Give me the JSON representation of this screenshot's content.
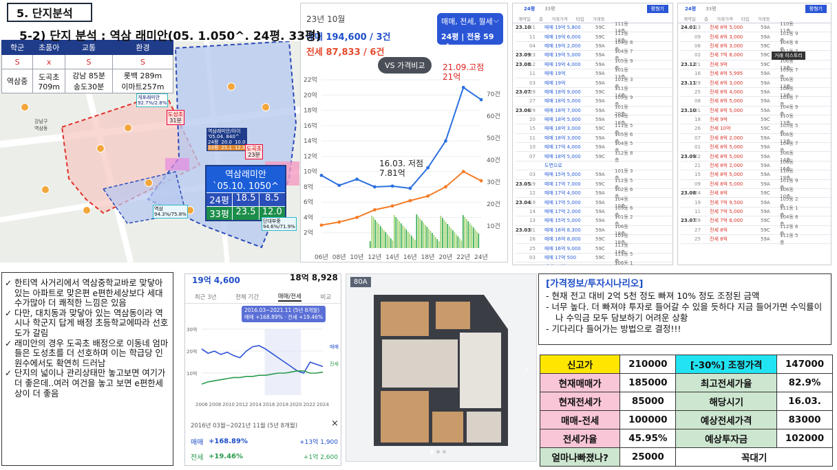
{
  "section_title": "5. 단지분석",
  "sub_title": "5-2) 단지 분석 : 역삼 래미안(05. 1.050^. 24평. 33평)",
  "school_table": {
    "headers": [
      "학군",
      "초품아",
      "교통",
      "환경"
    ],
    "grades": [
      "S",
      "x",
      "S",
      "S"
    ],
    "details": [
      "역삼중",
      "도곡초\n709m",
      "강남 85분\n송도30분",
      "롯백 289m\n이마트257m"
    ]
  },
  "map": {
    "labels": {
      "complex_main": "역삼래미안",
      "complex_year": "`05.10. 1050^",
      "row24": [
        "24평",
        "18.5",
        "8.5"
      ],
      "row33": [
        "33평",
        "23.5",
        "12.0"
      ],
      "pin_doseong": "도성초",
      "pin_doseong_d": "31분",
      "pin_dogok": "도곡초",
      "pin_dogok_d": "23분",
      "tag_a": "개포래미안\n92.7%/2.8%",
      "tag_b": "역삼래미안/아이\n'05.04. 840^",
      "tag_c": "역삼\n94.3%/75.8%",
      "tag_d": "단대부중\n94.6%/71.9%",
      "mini_rows": [
        [
          "24평",
          "20.0",
          "10.0"
        ],
        [
          "33평",
          "25.1",
          "12.9"
        ]
      ],
      "station": "강남구\n역삼동"
    }
  },
  "price_panel": {
    "month": "23년 10월",
    "sale": "매매 194,600 / 3건",
    "jeonse": "전세 87,833 / 6건",
    "filter": "매매, 전세, 월세",
    "pyeong": "24평 | 전용 59㎡",
    "vs_button": "VS 가격비교",
    "ann_high": "21.09.고점\n21억",
    "ann_low": "16.03. 저점\n7.81억"
  },
  "chart_data": {
    "type": "line",
    "x": [
      "06년",
      "08년",
      "10년",
      "12년",
      "14년",
      "16년",
      "18년",
      "20년",
      "22년",
      "24년"
    ],
    "y_left_ticks": [
      "2억",
      "4억",
      "6억",
      "8억",
      "10억",
      "12억",
      "14억",
      "16억",
      "18억",
      "20억",
      "22억"
    ],
    "y_right_ticks": [
      "10건",
      "20건",
      "30건",
      "40건",
      "50건",
      "60건",
      "70건"
    ],
    "series": [
      {
        "name": "매매",
        "values": [
          9.5,
          8.2,
          9.0,
          8.0,
          8.1,
          7.81,
          10.5,
          14.0,
          21.0,
          19.4
        ]
      },
      {
        "name": "전세",
        "values": [
          3.0,
          3.4,
          4.0,
          5.0,
          5.5,
          6.2,
          6.8,
          8.0,
          10.0,
          8.8
        ]
      }
    ],
    "ylim": [
      0,
      23
    ]
  },
  "tx_list_1": {
    "tabs": [
      "24평",
      "33평"
    ],
    "btn": "평형기",
    "header": [
      "계약일",
      "층",
      "거래가격",
      "타입",
      "거래동"
    ],
    "rows": [
      [
        "23.10",
        "21",
        "매매 19억 5,800",
        "59C",
        "111동 14층"
      ],
      [
        "",
        "11",
        "매매 19억 6,000",
        "59C",
        "111동 18층"
      ],
      [
        "",
        "04",
        "매매 19억 2,000",
        "59A",
        "104동 8층"
      ],
      [
        "23.09",
        "23",
        "매매 19억 5,000",
        "59A",
        "104동 7층"
      ],
      [
        "23.08",
        "12",
        "매매 19억 4,000",
        "59A",
        "105동 9층"
      ],
      [
        "",
        "11",
        "매매 19억",
        "59A",
        "101동 13층"
      ],
      [
        "",
        "03",
        "매매 19억",
        "59A",
        "101동 3층"
      ],
      [
        "23.07",
        "29",
        "매매 18억 9,000",
        "59C",
        "111동 14층"
      ],
      [
        "",
        "27",
        "매매 18억 5,000",
        "59A",
        "105동 9층"
      ],
      [
        "23.06",
        "29",
        "매매 18억 7,000",
        "59A",
        "101동 20층"
      ],
      [
        "",
        "20",
        "매매 18억 5,000",
        "59A",
        "104동 18층"
      ],
      [
        "",
        "15",
        "매매 18억 3,000",
        "59C",
        "111동 5층"
      ],
      [
        "",
        "11",
        "매매 18억 3,000",
        "59A",
        "105동 6층"
      ],
      [
        "",
        "10",
        "매매 17억 4,000",
        "59A",
        "104동 5층"
      ],
      [
        "",
        "07",
        "매매 18억 5,000",
        "59C",
        "112동 8층"
      ],
      [
        "",
        "",
        "도면으로",
        "",
        ""
      ],
      [
        "",
        "03",
        "매매 15억 5,000",
        "59A",
        "101동 3층"
      ],
      [
        "23.05",
        "19",
        "매매 17억 7,000",
        "59C",
        "112동 5층"
      ],
      [
        "",
        "12",
        "매매 17억 4,000",
        "59A",
        "102동 6층"
      ],
      [
        "23.04",
        "19",
        "매매 17억 5,000",
        "59A",
        "104동 10층"
      ],
      [
        "",
        "14",
        "매매 17억 2,000",
        "59A",
        "105동 6층"
      ],
      [
        "",
        "13",
        "매매 15억 5,000",
        "59A",
        "101동 2층"
      ],
      [
        "23.03",
        "31",
        "매매 16억 8,300",
        "59A",
        "106동 18층"
      ],
      [
        "",
        "26",
        "매매 16억 8,000",
        "59C",
        "101동 18층"
      ],
      [
        "",
        "25",
        "매매 16억 9,000",
        "59C",
        "111동 14층"
      ],
      [
        "",
        "03",
        "매매 17억 500",
        "59C",
        "111동 5층"
      ],
      [
        "",
        "18",
        "매매 16억 1,000",
        "59A",
        "106동 1층"
      ],
      [
        "23.02",
        "25",
        "매매 16억 7,000",
        "59A",
        "105동 6층"
      ]
    ]
  },
  "tx_list_2": {
    "tabs": [
      "24평",
      "33평"
    ],
    "btn": "평형기",
    "tooltip": "거래 히스토리",
    "header": [
      "계약일",
      "층",
      "거래가격",
      "타입",
      "거래동"
    ],
    "rows": [
      [
        "24.01",
        "13",
        "전세 8억 5,000",
        "59A",
        "110동 11층"
      ],
      [
        "",
        "09",
        "전세 8억 3,000",
        "59A",
        "101동 9층"
      ],
      [
        "",
        "06",
        "전세 8억 3,000",
        "59C",
        "104동 8층"
      ],
      [
        "",
        "02",
        "전세 7억 8,000",
        "59C",
        "111동 7층"
      ],
      [
        "23.12",
        "21",
        "전세 9억",
        "59C",
        "106동 13층"
      ],
      [
        "",
        "16",
        "전세 8억 5,995",
        "59A",
        "105동 7층"
      ],
      [
        "23.11",
        "29",
        "전세 8억 3,000",
        "59A",
        "106동 13층"
      ],
      [
        "",
        "25",
        "전세 8억 4,000",
        "59A",
        "106동 13층"
      ],
      [
        "",
        "08",
        "전세 8억 5,000",
        "59A",
        "101동 7층"
      ],
      [
        "23.10",
        "31",
        "전세 8억 5,000",
        "59A",
        "104동 9층"
      ],
      [
        "",
        "18",
        "전세 9억",
        "59C",
        "110동 13층"
      ],
      [
        "",
        "26",
        "전세 10억",
        "59C",
        "105동 5층"
      ],
      [
        "",
        "07",
        "전세 8억 2,000",
        "59A",
        "106동 13층"
      ],
      [
        "",
        "01",
        "전세 8억 5,000",
        "59A",
        "104동 7층"
      ],
      [
        "23.09",
        "22",
        "전세 8억 5,000",
        "59A",
        "106동 14층"
      ],
      [
        "",
        "21",
        "전세 8억 2,000",
        "59A",
        "106동 16층"
      ],
      [
        "",
        "15",
        "전세 8억 5,000",
        "59A",
        "110동 19층"
      ],
      [
        "",
        "09",
        "전세 8억 5,000",
        "59A",
        "101동 9층"
      ],
      [
        "23.08",
        "24",
        "전세 8억",
        "59C",
        "106동 10층"
      ],
      [
        "",
        "19",
        "전세 7억 9,500",
        "59A",
        "105동 2층"
      ],
      [
        "",
        "11",
        "전세 7억 5,000",
        "59A",
        "111동 1층"
      ],
      [
        "23.07",
        "29",
        "전세 7억 8,000",
        "59C",
        "104동 8층"
      ],
      [
        "",
        "27",
        "전세 8억",
        "59C",
        "112동 6층"
      ],
      [
        "",
        "25",
        "전세 8억",
        "59A",
        "111동 5층"
      ]
    ]
  },
  "notes": [
    "한티역 사거리에서 역삼중학교바로 맞닿아 있는 아파트로 맞은편 e편한세상보다 세대수가많아 더 쾌적한 느낌은 있음",
    "다만, 대치동과 맞닿아 있는 역삼동이라 역시나 학군지 답게 배정 초등학교에따라 선호도가 갈림",
    "래미안의 경우 도곡초 배정으로 이동네 엄마들은 도성초를 더 선호하며 이는 학급당 인원수에서도 확연히 드러남",
    "단지의 넓이나 관리상태만 놓고보면 여기가 더 좋은데..여러 여건을 놓고 보면 e편한세상이 더 좋음"
  ],
  "small_chart": {
    "sale_top": "19억 4,600",
    "other_top": "18억 8,928",
    "tabs": [
      "최근 3년",
      "전체 기간",
      "매매/전세",
      "비교"
    ],
    "tooltip_period": "2016.03~2021.11 (5년 8개월)",
    "tooltip_vals": "매매 +168.89% · 전세 +19.46%",
    "y_ticks": [
      "30억",
      "20억",
      "10억"
    ],
    "x_ticks": [
      "2006",
      "2008",
      "2010",
      "2012",
      "2014",
      "2016",
      "2018",
      "2020",
      "2022",
      "2024"
    ],
    "legend_sale": "매매",
    "legend_jeonse": "전세",
    "period_label": "2016년 03월~2021년 11월 (5년 8개월)",
    "close_icon": "×",
    "sale_label": "매매",
    "sale_pct": "+168.89%",
    "sale_amt": "+13억 1,900",
    "jeonse_label": "전세",
    "jeonse_pct": "+19.46%",
    "jeonse_amt": "+1억 2,600"
  },
  "floorplan": {
    "badge": "80A"
  },
  "info_box": {
    "title": "[가격정보/투자시나리오]",
    "lines": [
      "-  현재 전고 대비 2억 5천 정도 빠져 10% 정도 조정된 금액",
      "-  너무 높다. 더 빠져야 투자로 들어갈 수 있을 듯하다 지금 들어가면 수익률이나 수익금 모두 담보하기 어려운 상황",
      "-  기다리다 들어가는 방법으로 결정!!!"
    ]
  },
  "price_table": [
    [
      "신고가",
      "210000",
      "[-30%] 조정가격",
      "147000"
    ],
    [
      "현재매매가",
      "185000",
      "최고전세가율",
      "82.9%"
    ],
    [
      "현재전세가",
      "85000",
      "해당시기",
      "16.03."
    ],
    [
      "매매-전세",
      "100000",
      "예상전세가격",
      "83000"
    ],
    [
      "전세가율",
      "45.95%",
      "예상투자금",
      "102000"
    ],
    [
      "얼마나빠졌나?",
      "25000",
      "꼭대기",
      ""
    ]
  ],
  "colors": {
    "navy": "#1f3c8a",
    "blue": "#2a56d6",
    "orange": "#f47c25",
    "red": "#d9342b",
    "yellow": "#ffe600",
    "cyan": "#22e3f1"
  }
}
